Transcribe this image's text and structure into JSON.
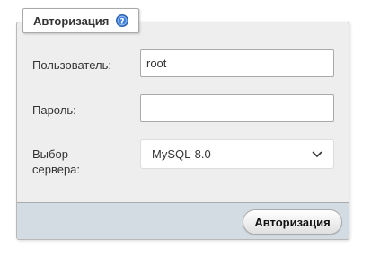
{
  "login": {
    "title": "Авторизация",
    "help_icon": "help-icon",
    "username": {
      "label": "Пользователь:",
      "value": "root"
    },
    "password": {
      "label": "Пароль:",
      "value": ""
    },
    "server": {
      "label_line1": "Выбор",
      "label_line2": "сервера:",
      "selected": "MySQL-8.0",
      "icon": "chevron-down-icon"
    },
    "submit_label": "Авторизация"
  },
  "colors": {
    "panel_bg": "#eeeeee",
    "footer_bg": "#d3dce3",
    "help_icon_blue": "#3f7fd6"
  }
}
